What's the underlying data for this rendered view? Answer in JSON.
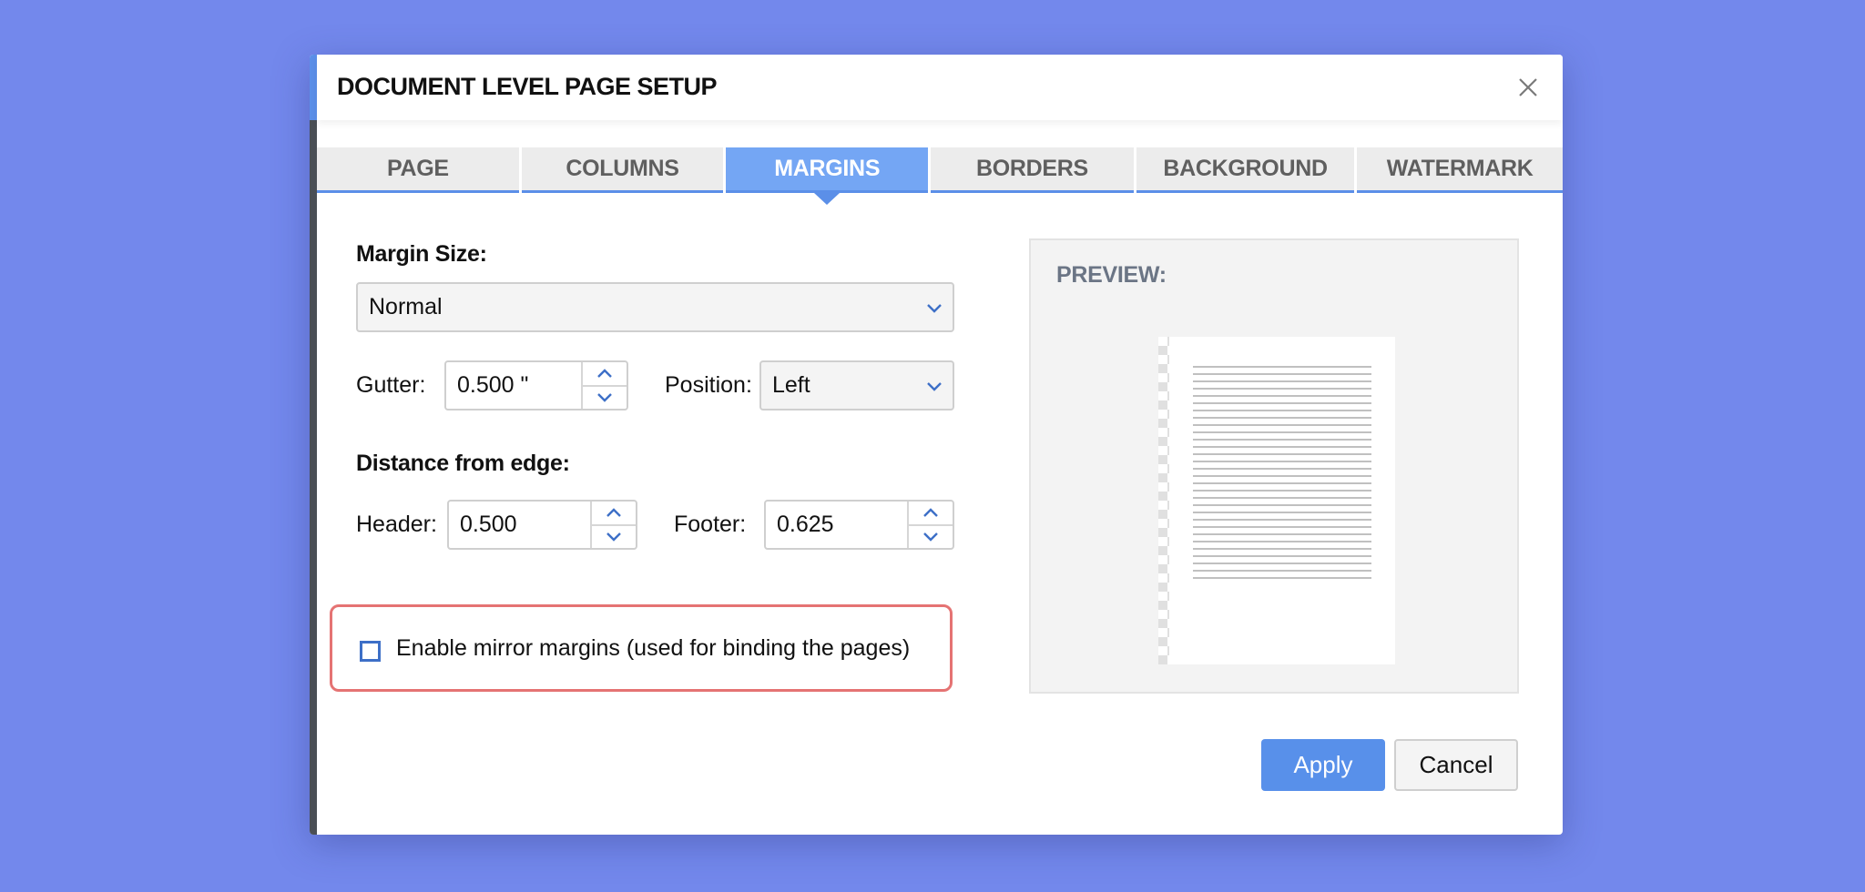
{
  "dialog": {
    "title": "DOCUMENT LEVEL PAGE SETUP",
    "close_icon": "close-icon"
  },
  "tabs": [
    {
      "label": "PAGE",
      "active": false
    },
    {
      "label": "COLUMNS",
      "active": false
    },
    {
      "label": "MARGINS",
      "active": true
    },
    {
      "label": "BORDERS",
      "active": false
    },
    {
      "label": "BACKGROUND",
      "active": false
    },
    {
      "label": "WATERMARK",
      "active": false
    }
  ],
  "margins": {
    "margin_size_label": "Margin Size:",
    "margin_size_value": "Normal",
    "gutter_label": "Gutter:",
    "gutter_value": "0.500 \"",
    "position_label": "Position:",
    "position_value": "Left",
    "distance_label": "Distance from edge:",
    "header_label": "Header:",
    "header_value": "0.500",
    "footer_label": "Footer:",
    "footer_value": "0.625",
    "mirror_label": "Enable mirror margins (used for binding the pages)",
    "mirror_checked": false
  },
  "preview": {
    "title": "PREVIEW:",
    "line_count": 30
  },
  "buttons": {
    "apply": "Apply",
    "cancel": "Cancel"
  },
  "colors": {
    "accent": "#5b8fe8",
    "active_tab": "#74a6f4",
    "apply_button": "#5890ea",
    "highlight_border": "#e57373",
    "background": "#7388ec"
  }
}
